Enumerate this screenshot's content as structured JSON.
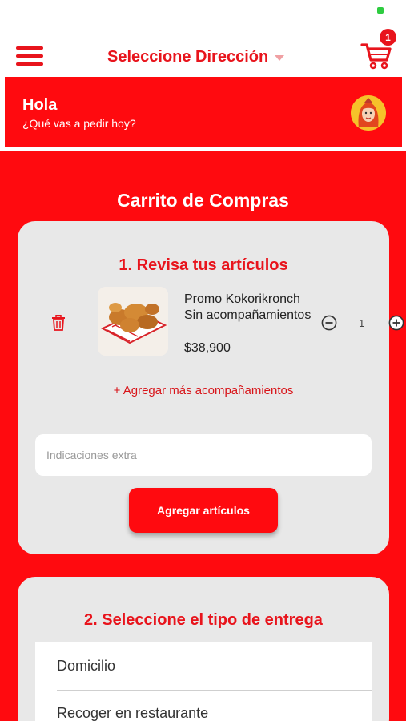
{
  "header": {
    "address_label": "Seleccione Dirección",
    "cart_count": "1"
  },
  "greeting": {
    "title": "Hola",
    "subtitle": "¿Qué vas a pedir hoy?"
  },
  "cart": {
    "title": "Carrito de Compras",
    "section1": {
      "title": "1. Revisa tus artículos",
      "items": [
        {
          "name": "Promo Kokorikronch Sin acompañamientos",
          "price": "$38,900",
          "quantity": "1"
        }
      ],
      "add_sides_link": "+ Agregar más acompañamientos",
      "extra_placeholder": "Indicaciones extra",
      "add_items_button": "Agregar artículos"
    },
    "section2": {
      "title": "2. Seleccione el tipo de entrega",
      "options": [
        "Domicilio",
        "Recoger en restaurante"
      ]
    }
  },
  "colors": {
    "primary": "#ff0a0f",
    "accent_text": "#e8141c",
    "card_bg": "#e8e8e8"
  },
  "icons": {
    "menu": "hamburger-icon",
    "cart": "shopping-cart-icon",
    "delete": "trash-icon",
    "decrease": "minus-circle-icon",
    "increase": "plus-circle-icon"
  }
}
